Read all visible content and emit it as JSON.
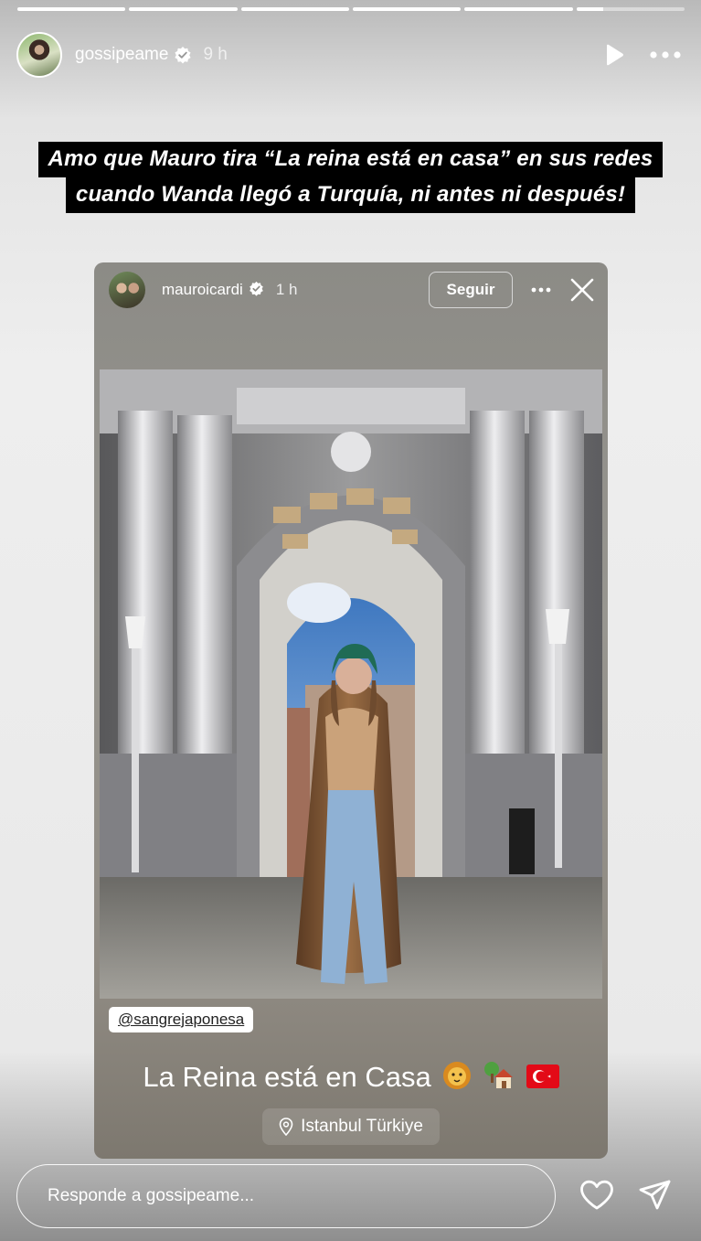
{
  "story": {
    "progress": {
      "segments": 6,
      "completed": 5,
      "current_fraction": 0.25
    },
    "header": {
      "username": "gossipeame",
      "time": "9 h"
    },
    "caption": {
      "line1": "Amo que Mauro tira “La reina está en casa” en sus redes",
      "line2": "cuando Wanda llegó a Turquía, ni antes ni después!"
    },
    "shared_post": {
      "username": "mauroicardi",
      "time": "1 h",
      "follow_label": "Seguir",
      "mention": "@sangrejaponesa",
      "text": "La Reina está en Casa",
      "emojis": [
        "lion",
        "house-with-tree",
        "turkey-flag"
      ],
      "location": "Istanbul Türkiye"
    },
    "reply": {
      "placeholder": "Responde a gossipeame..."
    }
  },
  "colors": {
    "verified": "#3897f0",
    "caption_bg": "#000000",
    "text": "#ffffff"
  }
}
